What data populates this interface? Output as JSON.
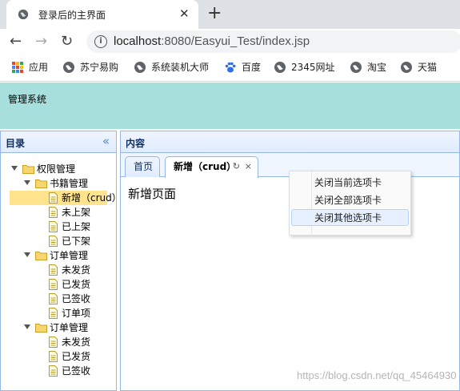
{
  "browser": {
    "tab_title": "登录后的主界面",
    "tab_close": "✕",
    "new_tab": "+",
    "back": "←",
    "forward": "→",
    "reload": "↻",
    "info": "i",
    "url_host": "localhost",
    "url_path": ":8080/Easyui_Test/index.jsp",
    "bookmarks": [
      {
        "label": "应用",
        "icon": "apps-grid-icon"
      },
      {
        "label": "苏宁易购",
        "icon": "globe-icon"
      },
      {
        "label": "系统装机大师",
        "icon": "globe-icon"
      },
      {
        "label": "百度",
        "icon": "baidu-paw-icon"
      },
      {
        "label": "2345网址",
        "icon": "globe-icon"
      },
      {
        "label": "淘宝",
        "icon": "globe-icon"
      },
      {
        "label": "天猫",
        "icon": "globe-icon"
      }
    ]
  },
  "app": {
    "header_title": "管理系统",
    "west": {
      "title": "目录",
      "collapse": "«",
      "tree": [
        {
          "label": "权限管理",
          "type": "folder"
        },
        {
          "label": "书籍管理",
          "type": "folder"
        },
        {
          "label": "新增（crud）",
          "type": "file",
          "selected": true
        },
        {
          "label": "未上架",
          "type": "file"
        },
        {
          "label": "已上架",
          "type": "file"
        },
        {
          "label": "已下架",
          "type": "file"
        },
        {
          "label": "订单管理",
          "type": "folder"
        },
        {
          "label": "未发货",
          "type": "file"
        },
        {
          "label": "已发货",
          "type": "file"
        },
        {
          "label": "已签收",
          "type": "file"
        },
        {
          "label": "订单项",
          "type": "file"
        },
        {
          "label": "订单管理",
          "type": "folder"
        },
        {
          "label": "未发货",
          "type": "file"
        },
        {
          "label": "已发货",
          "type": "file"
        },
        {
          "label": "已签收",
          "type": "file"
        }
      ]
    },
    "center": {
      "title": "内容",
      "tabs": [
        {
          "label": "首页"
        },
        {
          "label": "新增（crud）",
          "refresh": "↻",
          "close": "×"
        }
      ],
      "body_text": "新增页面"
    },
    "context_menu": [
      {
        "label": "关闭当前选项卡"
      },
      {
        "label": "关闭全部选项卡"
      },
      {
        "label": "关闭其他选项卡"
      }
    ]
  },
  "watermark": "https://blog.csdn.net/qq_45464930",
  "colors": {
    "header_bg": "#a6dfdc",
    "panel_border": "#95b8e7",
    "selected_bg": "#ffe48d"
  }
}
